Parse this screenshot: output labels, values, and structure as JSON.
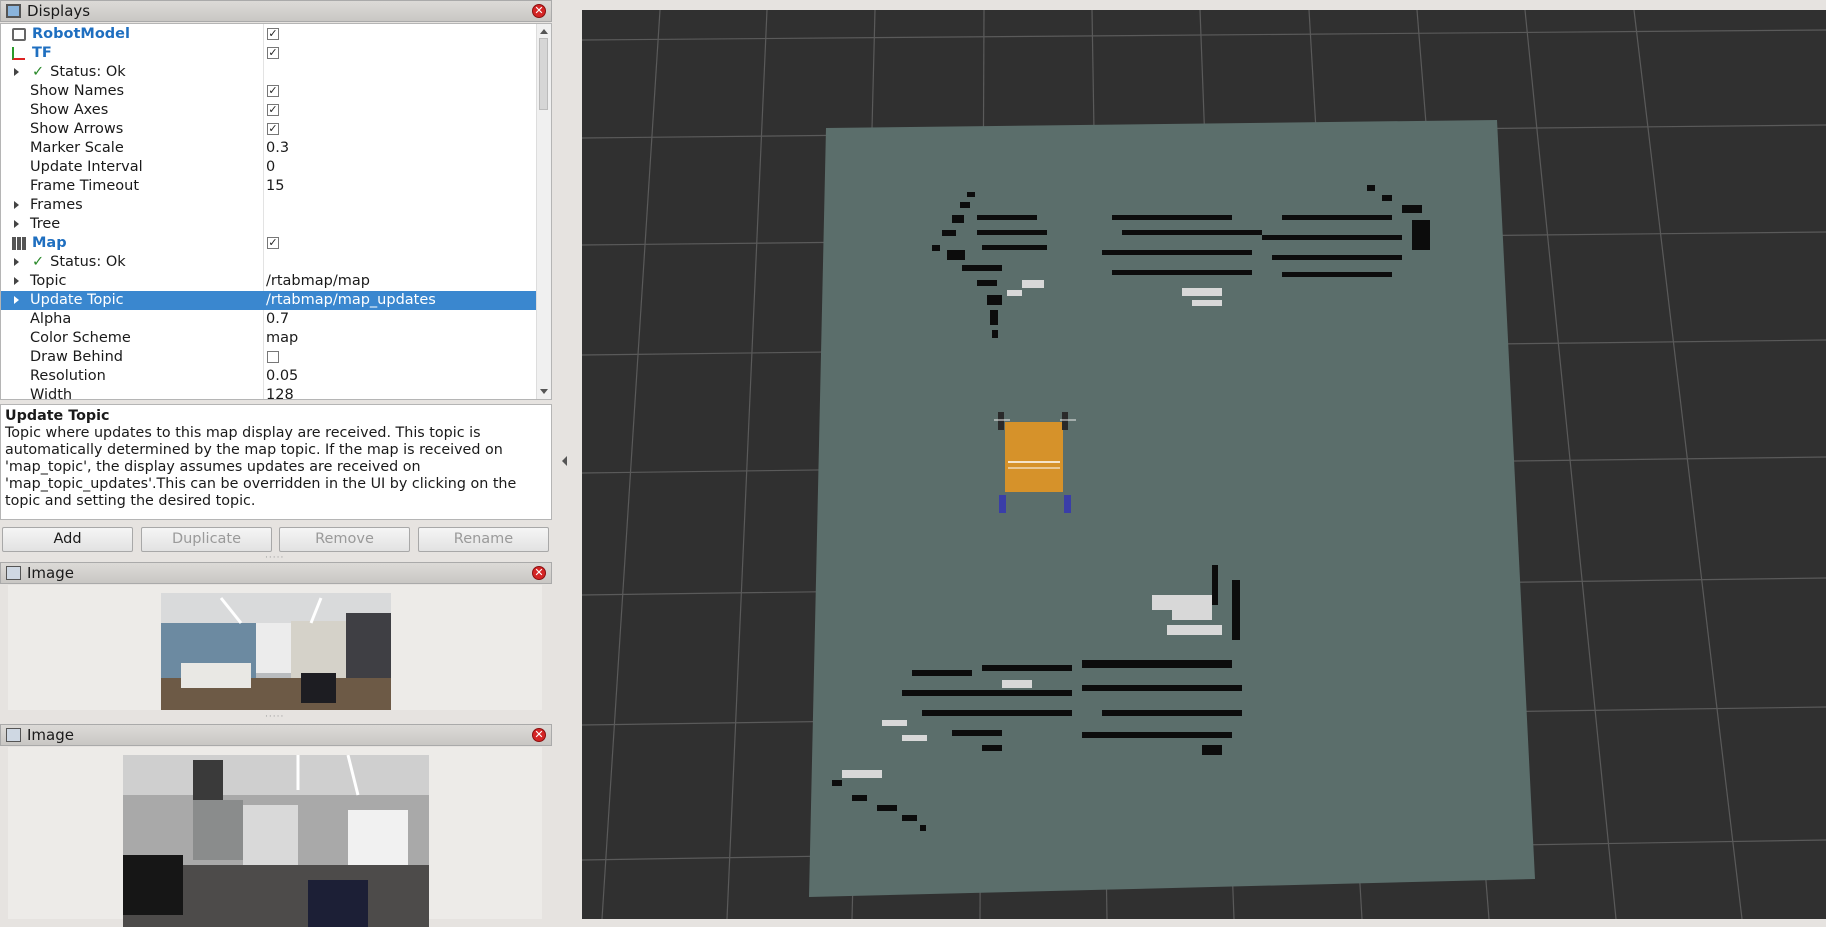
{
  "displays_panel": {
    "title": "Displays",
    "rows": [
      {
        "name": "RobotModel",
        "check": "✓"
      },
      {
        "name": "TF",
        "check": "✓"
      },
      {
        "name": "Status: Ok"
      },
      {
        "name": "Show Names",
        "check": "✓"
      },
      {
        "name": "Show Axes",
        "check": "✓"
      },
      {
        "name": "Show Arrows",
        "check": "✓"
      },
      {
        "name": "Marker Scale",
        "value": "0.3"
      },
      {
        "name": "Update Interval",
        "value": "0"
      },
      {
        "name": "Frame Timeout",
        "value": "15"
      },
      {
        "name": "Frames"
      },
      {
        "name": "Tree"
      },
      {
        "name": "Map",
        "check": "✓"
      },
      {
        "name": "Status: Ok"
      },
      {
        "name": "Topic",
        "value": "/rtabmap/map"
      },
      {
        "name": "Update Topic",
        "value": "/rtabmap/map_updates"
      },
      {
        "name": "Alpha",
        "value": "0.7"
      },
      {
        "name": "Color Scheme",
        "value": "map"
      },
      {
        "name": "Draw Behind",
        "check": ""
      },
      {
        "name": "Resolution",
        "value": "0.05"
      },
      {
        "name": "Width",
        "value": "128"
      }
    ]
  },
  "description": {
    "title": "Update Topic",
    "text": "Topic where updates to this map display are received. This topic is automatically determined by the map topic. If the map is received on 'map_topic', the display assumes updates are received on 'map_topic_updates'.This can be overridden in the UI by clicking on the topic and setting the desired topic."
  },
  "buttons": {
    "add": "Add",
    "duplicate": "Duplicate",
    "remove": "Remove",
    "rename": "Rename"
  },
  "image_panels": [
    {
      "title": "Image"
    },
    {
      "title": "Image"
    }
  ],
  "colors": {
    "selection": "#3a87cf",
    "link": "#1f6fc0",
    "map": "#5b6e6b",
    "robot": "#d6922a",
    "viewport": "#303030"
  },
  "icons": {
    "close": "close-icon",
    "expand": "expand-arrow-icon",
    "check": "checkmark-icon"
  }
}
